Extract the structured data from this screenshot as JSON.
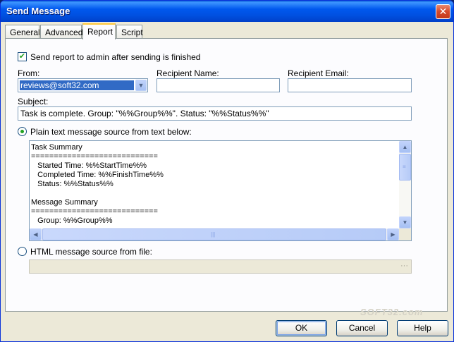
{
  "window": {
    "title": "Send Message",
    "close_glyph": "✕"
  },
  "tabs": [
    {
      "label": "General"
    },
    {
      "label": "Advanced"
    },
    {
      "label": "Report"
    },
    {
      "label": "Script"
    }
  ],
  "report": {
    "send_report_label": "Send report to admin after sending is finished",
    "send_report_checked": true,
    "from_label": "From:",
    "from_value": "reviews@soft32.com",
    "recipient_name_label": "Recipient Name:",
    "recipient_name_value": "",
    "recipient_email_label": "Recipient Email:",
    "recipient_email_value": "",
    "subject_label": "Subject:",
    "subject_value": "Task is complete. Group: \"%%Group%%\". Status: \"%%Status%%\"",
    "plain_text_label": "Plain text message source from text below:",
    "plain_text_selected": true,
    "body_lines": [
      "Task Summary",
      "============================",
      "   Started Time: %%StartTime%%",
      "   Completed Time: %%FinishTime%%",
      "   Status: %%Status%%",
      "",
      "Message Summary",
      "============================",
      "   Group: %%Group%%"
    ],
    "html_source_label": "HTML message source from file:",
    "html_source_selected": false,
    "html_file_value": "",
    "browse_glyph": "···"
  },
  "buttons": {
    "ok": "OK",
    "cancel": "Cancel",
    "help": "Help"
  },
  "watermark": "SOFT32.com",
  "icons": {
    "checkmark": "✔",
    "scroll_up": "▲",
    "scroll_down": "▼",
    "scroll_left": "◀",
    "scroll_right": "▶",
    "combo_arrow": "▼"
  }
}
